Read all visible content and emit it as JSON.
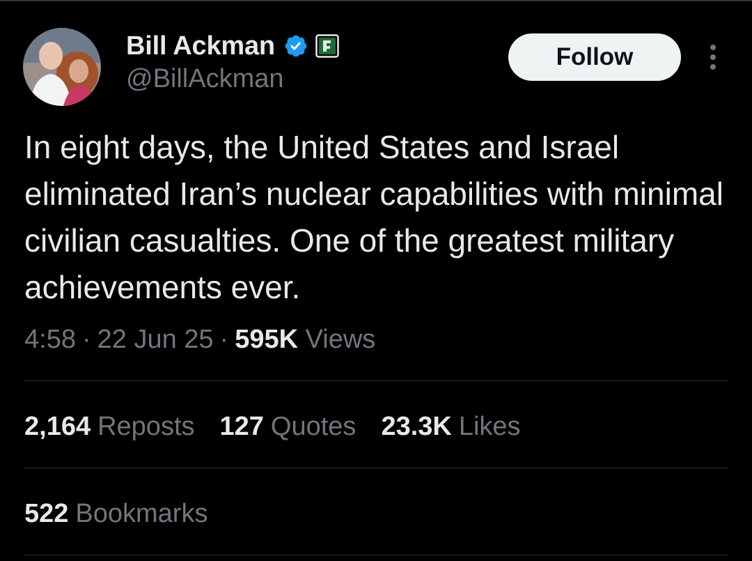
{
  "author": {
    "display_name": "Bill Ackman",
    "handle": "@BillAckman",
    "verified_badge": "verified-checkmark-icon",
    "affiliate_badge": "affiliate-badge-icon"
  },
  "actions": {
    "follow_label": "Follow",
    "more_icon": "more-vertical-icon"
  },
  "tweet": {
    "text": "In eight days, the United States and Israel eliminated Iran’s nuclear capabilities with minimal civilian casualties. One of the greatest military achievements ever.",
    "time": "4:58",
    "date": "22 Jun 25",
    "views_count": "595K",
    "views_label": "Views"
  },
  "stats": {
    "reposts": {
      "count": "2,164",
      "label": "Reposts"
    },
    "quotes": {
      "count": "127",
      "label": "Quotes"
    },
    "likes": {
      "count": "23.3K",
      "label": "Likes"
    },
    "bookmarks": {
      "count": "522",
      "label": "Bookmarks"
    }
  },
  "colors": {
    "background": "#000000",
    "primary_text": "#e7e9ea",
    "secondary_text": "#71767b",
    "verified_blue": "#1d9bf0",
    "affiliate_green": "#00ba7c",
    "divider": "#2f3336",
    "follow_bg": "#eff3f4"
  }
}
